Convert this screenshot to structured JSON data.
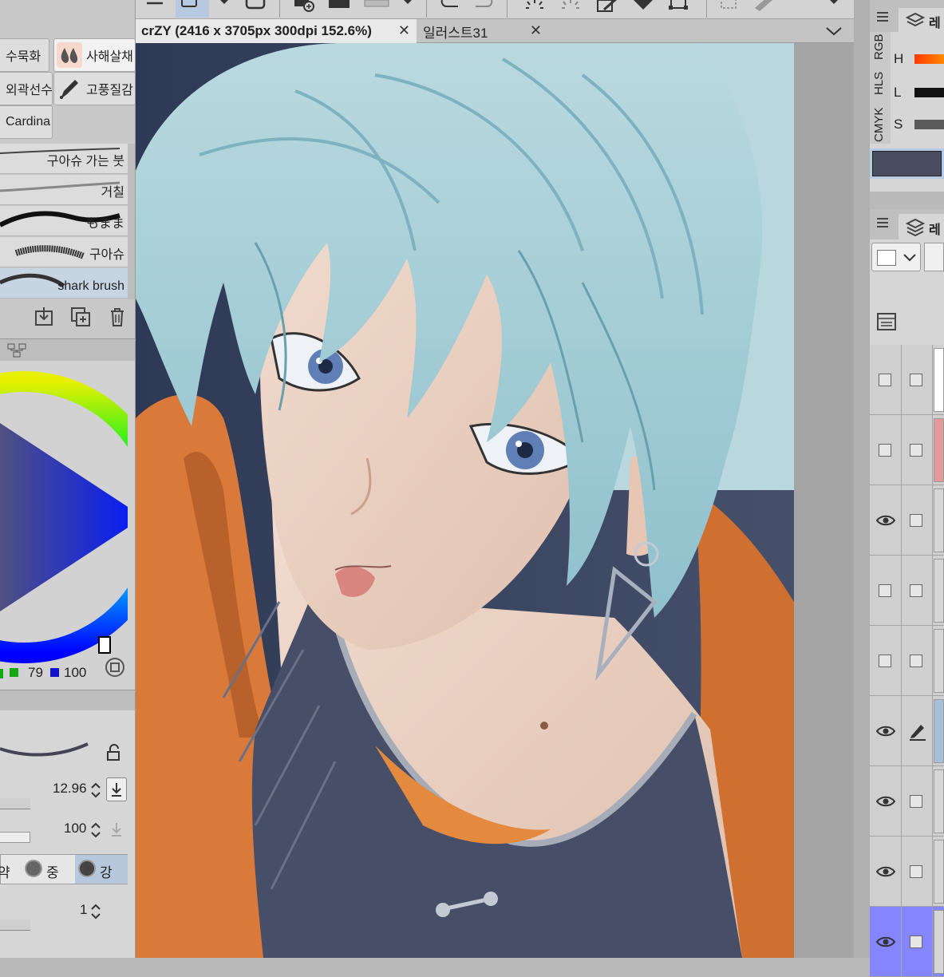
{
  "left_panel": {
    "subtools": [
      {
        "label": "수묵화",
        "icon": "ink-brush-icon"
      },
      {
        "label": "사해살채",
        "icon": "water-drops-icon"
      },
      {
        "label": "외곽선수",
        "icon": "outline-brush-icon"
      },
      {
        "label": "고풍질감",
        "icon": "pen-nib-icon"
      },
      {
        "label": "Cardina",
        "icon": "brush-icon"
      }
    ],
    "brushes": [
      {
        "label": "구아슈 가는 붓"
      },
      {
        "label": "거칠"
      },
      {
        "label": "もまま"
      },
      {
        "label": "구아슈"
      },
      {
        "label": "shark brush"
      }
    ],
    "rgb_values": {
      "g": "79",
      "b": "100"
    },
    "brush_size": "12.96",
    "opacity": "100",
    "strength_options": {
      "mid": "중",
      "strong": "강",
      "weak": "약"
    },
    "stabilization": "1"
  },
  "document_tabs": [
    {
      "title": "crZY (2416 x 3705px 300dpi 152.6%)",
      "active": true
    },
    {
      "title": "일러스트31",
      "active": false
    }
  ],
  "right_panel": {
    "color_mode_tabs": [
      "CMYK",
      "HLS",
      "RGB"
    ],
    "hls_labels": {
      "h": "H",
      "l": "L",
      "s": "S"
    },
    "current_color": "#4a4d60",
    "layer_panel_title_fragment": "레",
    "color_panel_title_fragment": "레",
    "layers": [
      {
        "visible": false,
        "locked": false,
        "selected": false
      },
      {
        "visible": false,
        "locked": false,
        "selected": false
      },
      {
        "visible": true,
        "locked": false,
        "selected": false
      },
      {
        "visible": false,
        "locked": false,
        "selected": false
      },
      {
        "visible": false,
        "locked": false,
        "selected": false
      },
      {
        "visible": true,
        "locked": false,
        "editing": true,
        "selected": false
      },
      {
        "visible": true,
        "locked": false,
        "selected": false
      },
      {
        "visible": true,
        "locked": false,
        "selected": false
      },
      {
        "visible": true,
        "locked": false,
        "selected": true
      }
    ]
  },
  "colors": {
    "selected_layer": "#8585ff",
    "selected_brush": "#c7d5e3",
    "hair": "#a9ccd4",
    "jacket": "#d9793a",
    "shirt": "#474e67",
    "skin": "#e9cfbf"
  }
}
